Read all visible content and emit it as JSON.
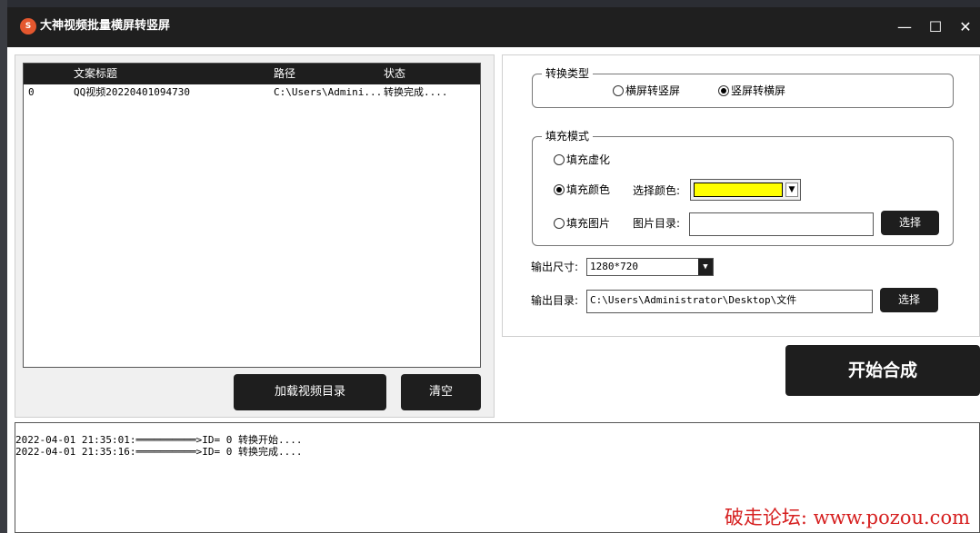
{
  "window": {
    "title": "大神视频批量横屏转竖屏",
    "icon": "app-logo-icon",
    "controls": {
      "minimize": "—",
      "maximize": "☐",
      "close": "✕"
    }
  },
  "list": {
    "columns": [
      "文案标题",
      "路径",
      "状态"
    ],
    "rows": [
      {
        "index": "0",
        "title": "QQ视频20220401094730",
        "path": "C:\\Users\\Admini...",
        "status": "转换完成...."
      }
    ]
  },
  "buttons": {
    "load_dir": "加载视频目录",
    "clear": "清空",
    "choose_picture": "选择",
    "choose_output": "选择",
    "start": "开始合成"
  },
  "convert_type": {
    "title": "转换类型",
    "options": [
      "横屏转竖屏",
      "竖屏转横屏"
    ],
    "selected": "竖屏转横屏"
  },
  "fill_mode": {
    "title": "填充模式",
    "options": [
      "填充虚化",
      "填充颜色",
      "填充图片"
    ],
    "selected": "填充颜色",
    "color_label": "选择颜色:",
    "color_value": "#ffff00",
    "picture_label": "图片目录:",
    "picture_dir": ""
  },
  "output": {
    "size_label": "输出尺寸:",
    "size_value": "1280*720",
    "dir_label": "输出目录:",
    "dir_value": "C:\\Users\\Administrator\\Desktop\\文件"
  },
  "log": {
    "lines": [
      "2022-04-01 21:35:01:══════════>ID= 0 转换开始....",
      "2022-04-01 21:35:16:══════════>ID= 0 转换完成...."
    ]
  },
  "watermark": "破走论坛: www.pozou.com"
}
